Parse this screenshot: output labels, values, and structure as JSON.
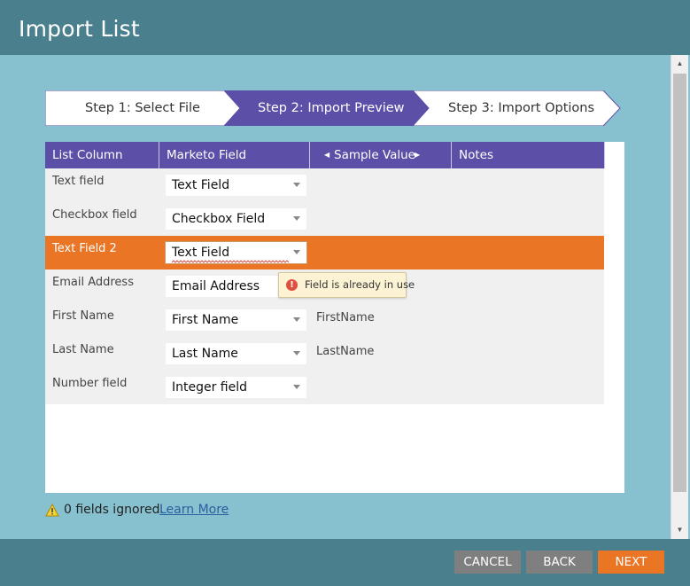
{
  "dialog": {
    "title": "Import List"
  },
  "steps": [
    {
      "label": "Step 1: Select File",
      "active": false
    },
    {
      "label": "Step 2: Import Preview",
      "active": true
    },
    {
      "label": "Step 3: Import Options",
      "active": false
    }
  ],
  "table": {
    "headers": {
      "list_column": "List Column",
      "marketo_field": "Marketo Field",
      "sample_value": "Sample Value",
      "notes": "Notes"
    },
    "rows": [
      {
        "column": "Text field",
        "field": "Text Field",
        "sample": "",
        "highlighted": false
      },
      {
        "column": "Checkbox field",
        "field": "Checkbox Field",
        "sample": "",
        "highlighted": false
      },
      {
        "column": "Text Field 2",
        "field": "Text Field",
        "sample": "",
        "highlighted": true
      },
      {
        "column": "Email Address",
        "field": "Email Address",
        "sample": "",
        "highlighted": false
      },
      {
        "column": "First Name",
        "field": "First Name",
        "sample": "FirstName",
        "highlighted": false
      },
      {
        "column": "Last Name",
        "field": "Last Name",
        "sample": "LastName",
        "highlighted": false
      },
      {
        "column": "Number field",
        "field": "Integer field",
        "sample": "",
        "highlighted": false
      }
    ]
  },
  "tooltip": {
    "text": "Field is already in use",
    "icon": "error-icon"
  },
  "footer_note": {
    "text": "0 fields ignored.",
    "link": "Learn More",
    "icon": "warning-icon"
  },
  "buttons": {
    "cancel": "CANCEL",
    "back": "BACK",
    "next": "NEXT"
  },
  "colors": {
    "header": "#4a7f8e",
    "body": "#87c1cf",
    "step_active": "#5b4fa8",
    "highlight": "#ea7625",
    "next_button": "#ea7625"
  }
}
